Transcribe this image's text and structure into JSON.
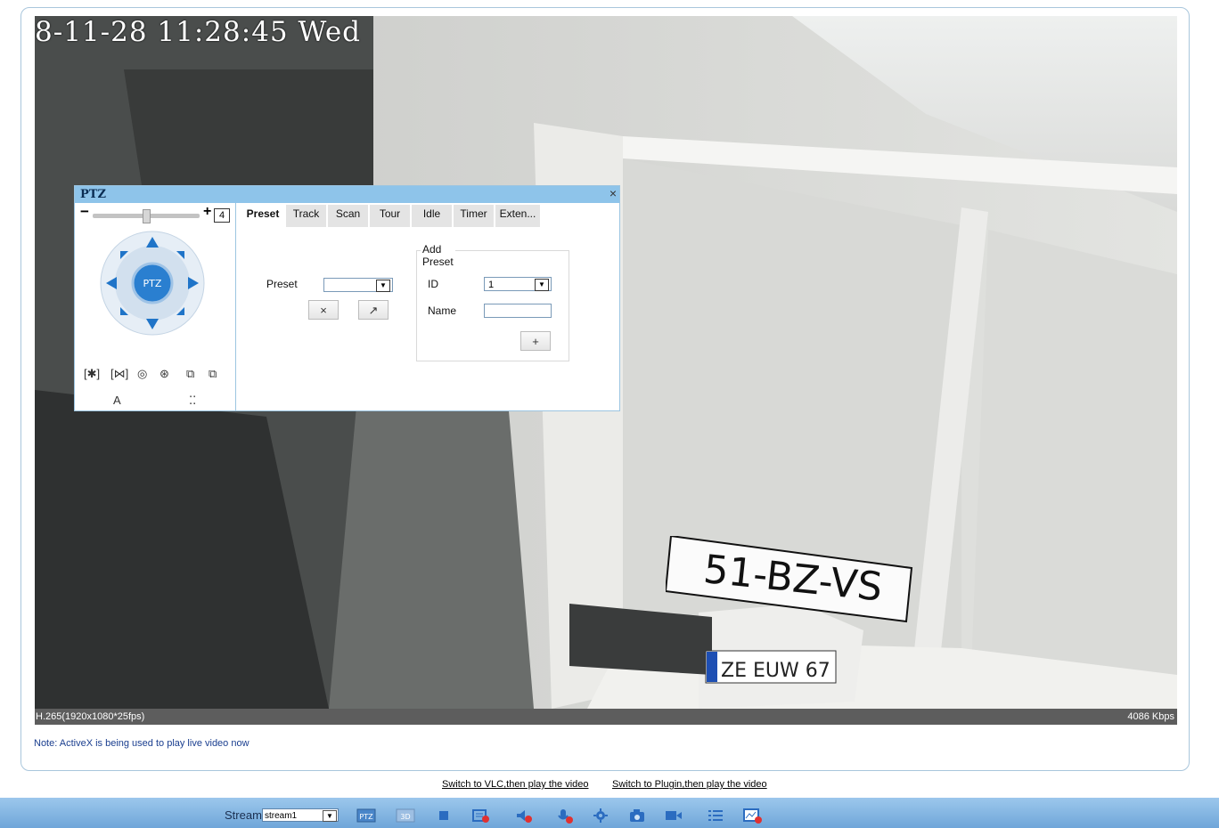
{
  "video": {
    "osd_time": "8-11-28 11:28:45 Wed",
    "codec": "H.265(1920x1080*25fps)",
    "bitrate": "4086 Kbps",
    "plate_main": "51-BZ-VS",
    "plate_small": "ZE EUW 67"
  },
  "note": "Note: ActiveX is being used to play live video now",
  "links": {
    "vlc": "Switch to VLC,then play the video",
    "plugin": "Switch to Plugin,then play the video"
  },
  "toolbar": {
    "stream_label": "Stream",
    "stream_value": "stream1",
    "icons": [
      "ptz-icon",
      "3d-icon",
      "stop-icon",
      "record-disabled-icon",
      "audio-muted-icon",
      "mic-muted-icon",
      "settings-icon",
      "snapshot-icon",
      "video-record-icon",
      "list-icon",
      "image-disabled-icon"
    ]
  },
  "ptz": {
    "title": "PTZ",
    "close": "×",
    "speed_value": "4",
    "center_label": "PTZ",
    "tabs": [
      "Preset",
      "Track",
      "Scan",
      "Tour",
      "Idle",
      "Timer",
      "Exten..."
    ],
    "active_tab": "Preset",
    "preset_label": "Preset",
    "preset_value": "",
    "delete_btn": "×",
    "goto_btn": "↗",
    "add_preset_legend": "Add Preset",
    "id_label": "ID",
    "id_value": "1",
    "name_label": "Name",
    "name_value": "",
    "add_btn": "+",
    "row_icons": [
      "[✱]",
      "[⋈]",
      "◎",
      "⊛",
      "⧉",
      "⧉"
    ],
    "row2_icons": [
      "A",
      "⁚⁚"
    ]
  },
  "colors": {
    "title_bar": "#8ec4ea",
    "toolbar": "#7fb3e0",
    "note": "#1a3e8f",
    "ptz_blue": "#2a7fd0"
  }
}
